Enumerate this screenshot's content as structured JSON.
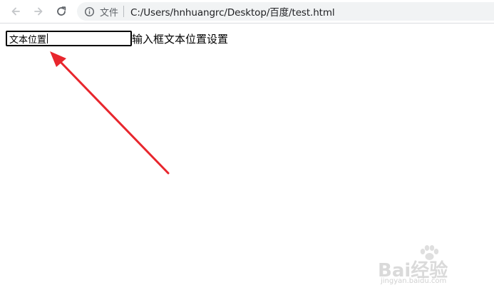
{
  "browser": {
    "security_label": "文件",
    "url": "C:/Users/hnhuangrc/Desktop/百度/test.html"
  },
  "content": {
    "input_value": "文本位置",
    "label": "输入框文本位置设置"
  },
  "watermark": {
    "brand": "Bai经验",
    "site": "jingyan.baidu.com"
  },
  "colors": {
    "arrow": "#e8262d",
    "toolbar_icon": "#5f6368",
    "omnibox_bg": "#f1f3f4"
  }
}
